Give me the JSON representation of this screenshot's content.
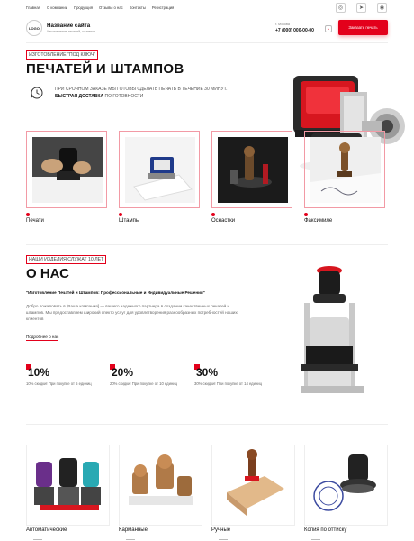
{
  "nav": [
    "Главная",
    "О компании",
    "Продукция",
    "Отзывы о нас",
    "Контакты",
    "Регистрация"
  ],
  "social": [
    {
      "icon": "whatsapp-icon",
      "glyph": "◎"
    },
    {
      "icon": "telegram-icon",
      "glyph": "➤"
    },
    {
      "icon": "viber-icon",
      "glyph": "◉"
    }
  ],
  "header": {
    "logo": "LOGO",
    "site_name": "Название сайта",
    "site_sub": "Изготовление печатей, штампов",
    "city": "г. Москва",
    "phone": "+7 (000) 000-00-00",
    "order_button": "Заказать печать"
  },
  "hero": {
    "tag": "ИЗГОТОВЛЕНИЕ \"ПОД КЛЮЧ\"",
    "title": "ПЕЧАТЕЙ И ШТАМПОВ",
    "promo_line1": "ПРИ СРОЧНОМ ЗАКАЗЕ МЫ ГОТОВЫ СДЕЛАТЬ ПЕЧАТЬ В ТЕЧЕНИЕ 30 МИНУТ.",
    "promo_bold": "БЫСТРАЯ ДОСТАВКА",
    "promo_rest": " ПО ГОТОВНОСТИ"
  },
  "categories": [
    "Печати",
    "Штампы",
    "Оснастки",
    "Факсимиле"
  ],
  "about": {
    "tag": "НАШИ ИЗДЕЛИЯ СЛУЖАТ 10 ЛЕТ",
    "title": "О НАС",
    "subtitle": "\"Изготовление Печатей и Штампов: Профессиональные и Индивидуальные Решения\"",
    "text": "Добро пожаловать в [Ваша компания] — вашего надежного партнера в создании качественных печатей и штампов. Мы предоставляем широкий спектр услуг для удовлетворения разнообразных потребностей наших клиентов",
    "more": "Подробнее о нас"
  },
  "discounts": [
    {
      "value": "10%",
      "text": "10% скидки! При покупке от 5 единиц"
    },
    {
      "value": "20%",
      "text": "20% скидки! При покупке от 10 единиц"
    },
    {
      "value": "30%",
      "text": "30% скидки! При покупке от 14 единиц"
    }
  ],
  "products": [
    "Автоматические",
    "Карманные",
    "Ручные",
    "Копия по оттиску"
  ],
  "colors": {
    "accent": "#e3001b"
  }
}
